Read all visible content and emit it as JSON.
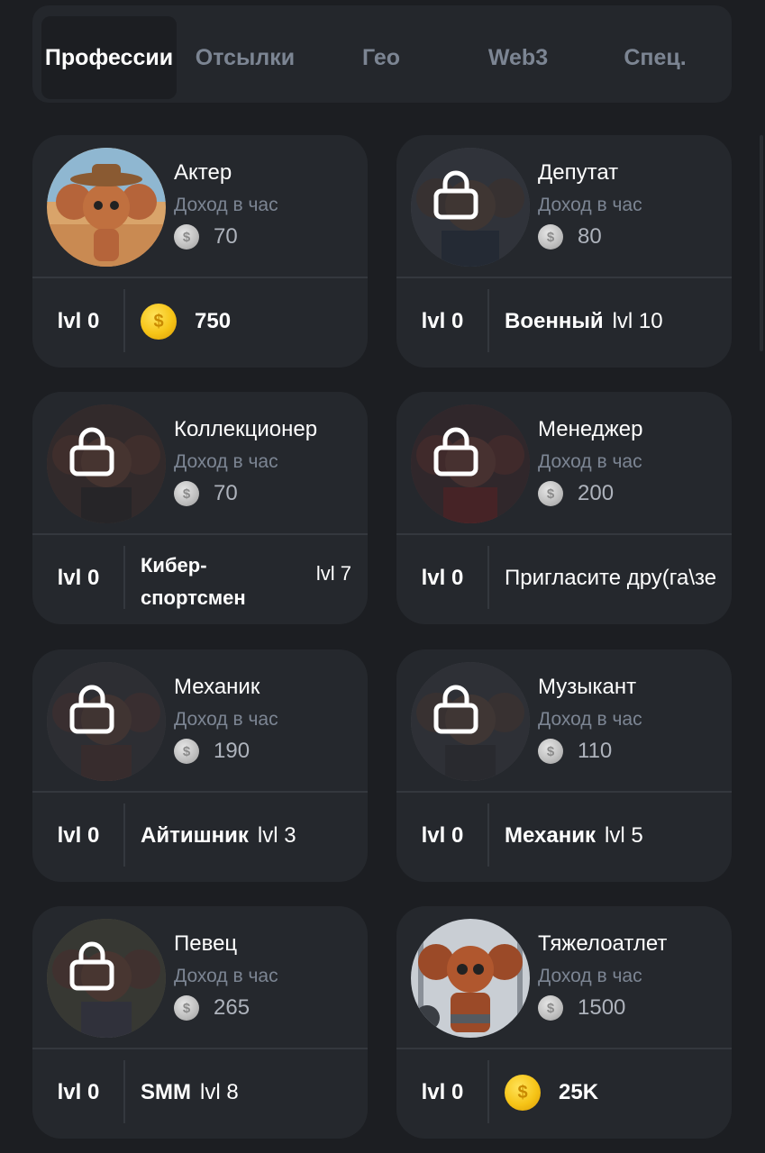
{
  "tabs": [
    {
      "label": "Профессии",
      "active": true
    },
    {
      "label": "Отсылки"
    },
    {
      "label": "Гео"
    },
    {
      "label": "Web3"
    },
    {
      "label": "Спец."
    }
  ],
  "income_label": "Доход в час",
  "lvl_label": "lvl 0",
  "cards": [
    {
      "name": "Актер",
      "income": "70",
      "locked": false,
      "price": "750",
      "avatar_color": "#b5643a"
    },
    {
      "name": "Депутат",
      "income": "80",
      "locked": true,
      "req_name": "Военный",
      "req_lvl": "lvl 10",
      "avatar_color": "#3b4048"
    },
    {
      "name": "Коллекционер",
      "income": "70",
      "locked": true,
      "req_line1": "Кибер-",
      "req_line2": "спортсмен",
      "req_lvl": "lvl 7",
      "avatar_color": "#4a3632"
    },
    {
      "name": "Менеджер",
      "income": "200",
      "locked": true,
      "req_text": "Пригласите дру(га\\зе",
      "avatar_color": "#4b2d2d"
    },
    {
      "name": "Механик",
      "income": "190",
      "locked": true,
      "req_name": "Айтишник",
      "req_lvl": "lvl 3",
      "avatar_color": "#3e3a3a"
    },
    {
      "name": "Музыкант",
      "income": "110",
      "locked": true,
      "req_name": "Механик",
      "req_lvl": "lvl 5",
      "avatar_color": "#3a3b40"
    },
    {
      "name": "Певец",
      "income": "265",
      "locked": true,
      "req_name": "SMM",
      "req_lvl": "lvl 8",
      "avatar_color": "#4a4a3e"
    },
    {
      "name": "Тяжелоатлет",
      "income": "1500",
      "locked": false,
      "price": "25K",
      "avatar_color": "#9b4a28"
    }
  ],
  "colors": {
    "background": "#1c1e22",
    "card": "#25282d",
    "muted_text": "#7c8593",
    "gold": "#f6c417"
  },
  "icons": {
    "lock": "lock-icon",
    "silver_coin": "silver-coin-icon",
    "gold_coin": "gold-coin-icon"
  }
}
